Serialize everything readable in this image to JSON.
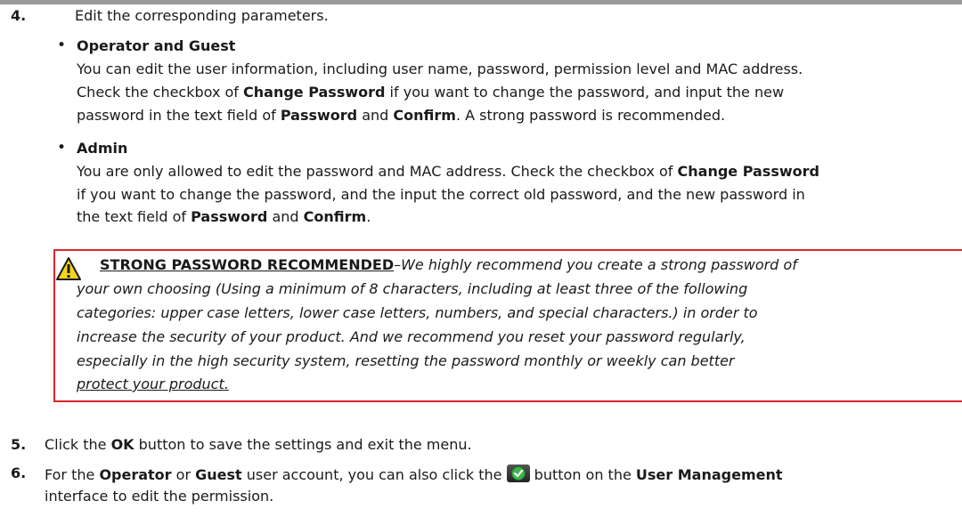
{
  "steps": {
    "s4": {
      "num": "4.",
      "text": "Edit the corresponding parameters."
    },
    "s5": {
      "num": "5.",
      "pre": "Click the ",
      "b1": "OK",
      "post": " button to save the settings and exit the menu."
    },
    "s6": {
      "num": "6.",
      "pre": "For the ",
      "b1": "Operator",
      "mid1": " or ",
      "b2": "Guest",
      "mid2": " user account, you can also click the ",
      "mid3": " button on the ",
      "b3": "User Management",
      "line2": "interface to edit the permission.",
      "icon": "green-check-icon"
    }
  },
  "operator": {
    "title": "Operator and Guest",
    "l1": "You can edit the user information, including user name, password, permission level and MAC address.",
    "l2a": "Check the checkbox of ",
    "l2b": "Change Password",
    "l2c": " if you want to change the password, and input the new",
    "l3a": "password in the text field of ",
    "l3b": "Password",
    "l3c": " and ",
    "l3d": "Confirm",
    "l3e": ". A strong password is recommended."
  },
  "admin": {
    "title": "Admin",
    "l1a": "You are only allowed to edit the password and MAC address. Check the checkbox of ",
    "l1b": "Change Password",
    "l2": "if you want to change the password, and the input the correct old password, and the new password in",
    "l3a": "the text field of ",
    "l3b": "Password",
    "l3c": " and ",
    "l3d": "Confirm",
    "l3e": "."
  },
  "warning": {
    "title": "STRONG PASSWORD RECOMMENDED",
    "l1": "–We highly recommend you create a strong password of",
    "l2": "your own choosing (Using a minimum of 8 characters, including at least three of the following",
    "l3": "categories: upper case letters, lower case letters, numbers, and special characters.) in order to",
    "l4": "increase the security of your product. And we recommend you reset your password regularly,",
    "l5": "especially in the high security system, resetting the password monthly or weekly can better",
    "l6": "protect your product.",
    "icon": "warning-triangle-icon",
    "border_color": "#d9262b"
  }
}
